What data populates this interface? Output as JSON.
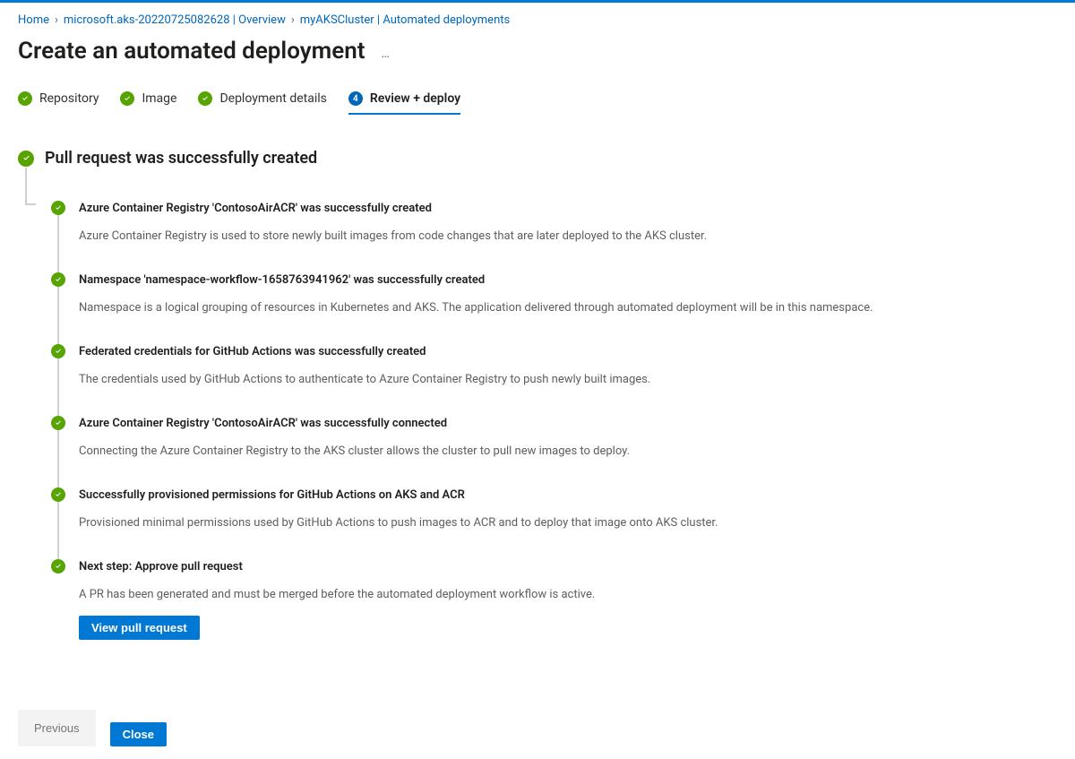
{
  "breadcrumb": {
    "items": [
      {
        "label": "Home"
      },
      {
        "label": "microsoft.aks-20220725082628 | Overview"
      },
      {
        "label": "myAKSCluster | Automated deployments"
      }
    ]
  },
  "header": {
    "title": "Create an automated deployment"
  },
  "stepper": {
    "steps": [
      {
        "label": "Repository",
        "state": "done"
      },
      {
        "label": "Image",
        "state": "done"
      },
      {
        "label": "Deployment details",
        "state": "done"
      },
      {
        "label": "Review + deploy",
        "state": "active",
        "number": "4"
      }
    ]
  },
  "status": {
    "heading": "Pull request was successfully created"
  },
  "timeline": [
    {
      "title": "Azure Container Registry 'ContosoAirACR' was successfully created",
      "desc": "Azure Container Registry is used to store newly built images from code changes that are later deployed to the AKS cluster."
    },
    {
      "title": "Namespace 'namespace-workflow-1658763941962' was successfully created",
      "desc": "Namespace is a logical grouping of resources in Kubernetes and AKS. The application delivered through automated deployment will be in this namespace."
    },
    {
      "title": "Federated credentials for GitHub Actions was successfully created",
      "desc": "The credentials used by GitHub Actions to authenticate to Azure Container Registry to push newly built images."
    },
    {
      "title": "Azure Container Registry 'ContosoAirACR' was successfully connected",
      "desc": "Connecting the Azure Container Registry to the AKS cluster allows the cluster to pull new images to deploy."
    },
    {
      "title": "Successfully provisioned permissions for GitHub Actions on AKS and ACR",
      "desc": "Provisioned minimal permissions used by GitHub Actions to push images to ACR and to deploy that image onto AKS cluster."
    },
    {
      "title": "Next step: Approve pull request",
      "desc": "A PR has been generated and must be merged before the automated deployment workflow is active.",
      "action_label": "View pull request"
    }
  ],
  "footer": {
    "previous_label": "Previous",
    "close_label": "Close"
  }
}
